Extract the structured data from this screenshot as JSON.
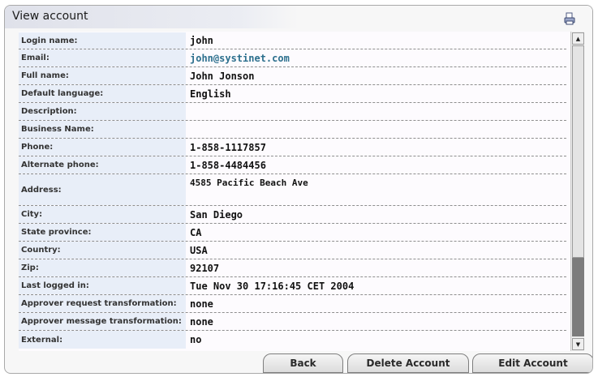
{
  "window": {
    "title": "View account"
  },
  "fields": [
    {
      "label": "Login name:",
      "value": "john"
    },
    {
      "label": "Email:",
      "value": "john@systinet.com"
    },
    {
      "label": "Full name:",
      "value": "John Jonson"
    },
    {
      "label": "Default language:",
      "value": "English"
    },
    {
      "label": "Description:",
      "value": ""
    },
    {
      "label": "Business Name:",
      "value": ""
    },
    {
      "label": "Phone:",
      "value": "1-858-1117857"
    },
    {
      "label": "Alternate phone:",
      "value": "1-858-4484456"
    },
    {
      "label": "Address:",
      "value": "4585 Pacific Beach Ave"
    },
    {
      "label": "City:",
      "value": "San Diego"
    },
    {
      "label": "State province:",
      "value": "CA"
    },
    {
      "label": "Country:",
      "value": "USA"
    },
    {
      "label": "Zip:",
      "value": "92107"
    },
    {
      "label": "Last logged in:",
      "value": "Tue Nov 30 17:16:45 CET 2004"
    },
    {
      "label": "Approver request transformation:",
      "value": "none"
    },
    {
      "label": "Approver message transformation:",
      "value": "none"
    },
    {
      "label": "External:",
      "value": "no"
    }
  ],
  "buttons": {
    "back": "Back",
    "delete": "Delete Account",
    "edit": "Edit Account"
  },
  "icons": {
    "print": "printer-icon",
    "scroll_up": "arrow-up-icon",
    "scroll_down": "arrow-down-icon"
  }
}
